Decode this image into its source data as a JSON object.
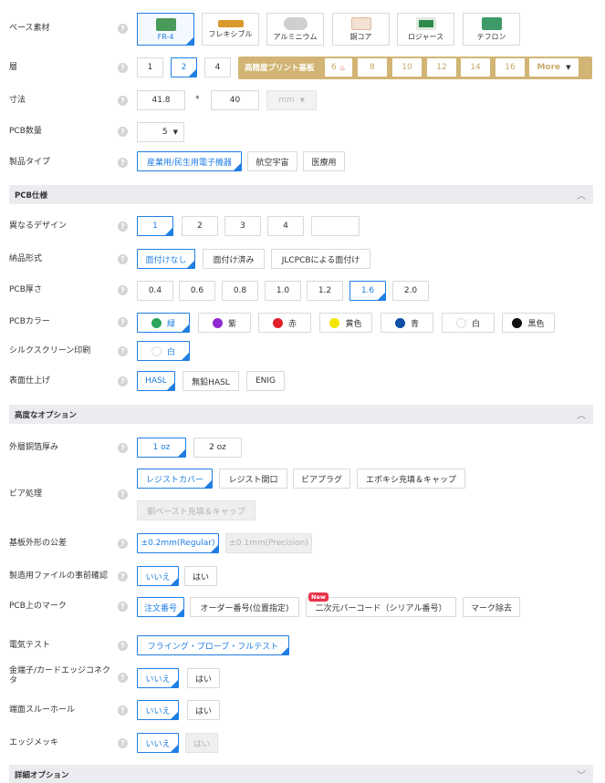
{
  "base_material": {
    "label": "ベース素材",
    "options": [
      {
        "label": "FR-4",
        "color": "#4a9a5a"
      },
      {
        "label": "フレキシブル",
        "color": "#d99a2b"
      },
      {
        "label": "アルミニウム",
        "color": "#cfcfcf"
      },
      {
        "label": "銅コア",
        "color": "#e0b8a0"
      },
      {
        "label": "ロジャース",
        "color": "#2f8a4a"
      },
      {
        "label": "テフロン",
        "color": "#3e9a68"
      }
    ]
  },
  "layers": {
    "label": "層",
    "options": [
      "1",
      "2",
      "4"
    ],
    "hd_title": "高精度プリント基板",
    "hd_options": [
      "6",
      "8",
      "10",
      "12",
      "14",
      "16"
    ],
    "more": "More"
  },
  "dimensions": {
    "label": "寸法",
    "width": "41.8",
    "sep": "*",
    "height": "40",
    "unit": "mm"
  },
  "quantity": {
    "label": "PCB数量",
    "value": "5"
  },
  "product_type": {
    "label": "製品タイプ",
    "options": [
      "産業用/民生用電子機器",
      "航空宇宙",
      "医療用"
    ]
  },
  "spec_section": {
    "title": "PCB仕様"
  },
  "different_designs": {
    "label": "異なるデザイン",
    "options": [
      "1",
      "2",
      "3",
      "4",
      ""
    ]
  },
  "delivery_format": {
    "label": "納品形式",
    "options": [
      "面付けなし",
      "面付け済み",
      "JLCPCBによる面付け"
    ]
  },
  "thickness": {
    "label": "PCB厚さ",
    "options": [
      "0.4",
      "0.6",
      "0.8",
      "1.0",
      "1.2",
      "1.6",
      "2.0"
    ]
  },
  "pcb_color": {
    "label": "PCBカラー",
    "options": [
      {
        "label": "緑",
        "color": "#2aa65b"
      },
      {
        "label": "紫",
        "color": "#8f2ad1"
      },
      {
        "label": "赤",
        "color": "#e0202a"
      },
      {
        "label": "黄色",
        "color": "#f3e600"
      },
      {
        "label": "青",
        "color": "#0e4fa8"
      },
      {
        "label": "白",
        "color": "#ffffff"
      },
      {
        "label": "黒色",
        "color": "#111111"
      }
    ]
  },
  "silkscreen": {
    "label": "シルクスクリーン印刷",
    "value": "白"
  },
  "surface_finish": {
    "label": "表面仕上げ",
    "options": [
      "HASL",
      "無鉛HASL",
      "ENIG"
    ]
  },
  "advanced_section": {
    "title": "高度なオプション"
  },
  "outer_copper": {
    "label": "外層銅箔厚み",
    "options": [
      "1 oz",
      "2 oz"
    ]
  },
  "via": {
    "label": "ビア処理",
    "options": [
      "レジストカバー",
      "レジスト開口",
      "ビアプラグ",
      "エポキシ充填＆キャップ",
      "銅ペースト充填＆キャップ"
    ]
  },
  "tolerance": {
    "label": "基板外形の公差",
    "options": [
      "±0.2mm(Regular)",
      "±0.1mm(Precision)"
    ]
  },
  "confirm_files": {
    "label": "製造用ファイルの事前確認",
    "options": [
      "いいえ",
      "はい"
    ]
  },
  "marking": {
    "label": "PCB上のマーク",
    "options": [
      "注文番号",
      "オーダー番号(位置指定)",
      "二次元バーコード（シリアル番号）",
      "マーク除去"
    ],
    "new_badge": "New"
  },
  "electrical_test": {
    "label": "電気テスト",
    "value": "フライング・プローブ・フルテスト"
  },
  "gold_fingers": {
    "label": "金端子/カードエッジコネクタ",
    "options": [
      "いいえ",
      "はい"
    ]
  },
  "castellated": {
    "label": "端面スルーホール",
    "options": [
      "いいえ",
      "はい"
    ]
  },
  "edge_plating": {
    "label": "エッジメッキ",
    "options": [
      "いいえ",
      "はい"
    ]
  },
  "detail_section": {
    "title": "詳細オプション"
  },
  "help_icon": "?",
  "colors": {
    "accent": "#1f7ee3",
    "gold": "#d2b574",
    "fire": "#e03b3b"
  }
}
